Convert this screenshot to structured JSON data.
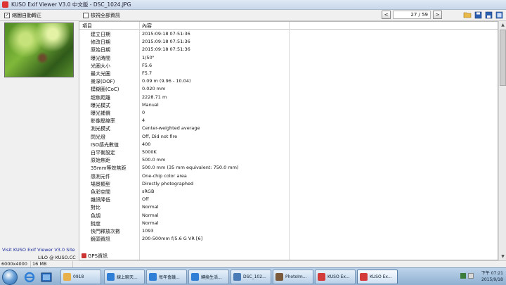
{
  "window": {
    "title": "KUSO Exif Viewer V3.0 中文版 - DSC_1024.JPG"
  },
  "toolbar": {
    "auto_rotate_label": "縮圖自動轉正",
    "auto_rotate_checked": true,
    "show_all_label": "檢視全部資訊",
    "show_all_checked": false,
    "prev_label": "<",
    "next_label": ">",
    "counter": "27 / 59"
  },
  "left": {
    "visit_text": "Visit KUSO Exif Viewer V3.0 Site",
    "credit_text": "LILO @ KUSO.CC"
  },
  "table": {
    "headers": [
      "項目",
      "內容"
    ],
    "rows": [
      {
        "key": "建立日期",
        "value": "2015:09:18 07:51:36"
      },
      {
        "key": "修改日期",
        "value": "2015:09:18 07:51:36"
      },
      {
        "key": "原始日期",
        "value": "2015:09:18 07:51:36"
      },
      {
        "key": "曝光時間",
        "value": "1/50\""
      },
      {
        "key": "光圈大小",
        "value": "F5.6"
      },
      {
        "key": "最大光圈",
        "value": "F5.7"
      },
      {
        "key": "景深(DOF)",
        "value": "0.09 m (9.96 - 10.04)"
      },
      {
        "key": "模糊圈(CoC)",
        "value": "0.020 mm"
      },
      {
        "key": "超焦距離",
        "value": "2228.71 m"
      },
      {
        "key": "曝光模式",
        "value": "Manual"
      },
      {
        "key": "曝光補償",
        "value": "0"
      },
      {
        "key": "影像壓縮率",
        "value": "4"
      },
      {
        "key": "測光模式",
        "value": "Center-weighted average"
      },
      {
        "key": "閃光燈",
        "value": "Off, Did not fire"
      },
      {
        "key": "ISO感光數值",
        "value": "400"
      },
      {
        "key": "白平衡設定",
        "value": "5000K"
      },
      {
        "key": "原始焦距",
        "value": "500.0 mm"
      },
      {
        "key": "35mm等效焦距",
        "value": "500.0 mm (35 mm equivalent: 750.0 mm)"
      },
      {
        "key": "感測元件",
        "value": "One-chip color area"
      },
      {
        "key": "場景類型",
        "value": "Directly photographed"
      },
      {
        "key": "色彩空間",
        "value": "sRGB"
      },
      {
        "key": "雜訊降低",
        "value": "Off"
      },
      {
        "key": "對比",
        "value": "Normal"
      },
      {
        "key": "色調",
        "value": "Normal"
      },
      {
        "key": "銳度",
        "value": "Normal"
      },
      {
        "key": "快門釋放次數",
        "value": "1093"
      },
      {
        "key": "鏡頭資訊",
        "value": "200-500mm f/5.6 G VR [6]"
      }
    ],
    "gps_label": "GPS資訊"
  },
  "status": {
    "dimensions": "6000x4000",
    "filesize": "16 MB"
  },
  "taskbar": {
    "items": [
      {
        "label": "0918",
        "icon": "folder-icon",
        "color": "#e8b04a"
      },
      {
        "label": "線上聊天...",
        "icon": "ie-icon",
        "color": "#2f7fd6"
      },
      {
        "label": "每年會議...",
        "icon": "ie-icon",
        "color": "#2f7fd6"
      },
      {
        "label": "轉換生活...",
        "icon": "ie-icon",
        "color": "#2f7fd6"
      },
      {
        "label": "DSC_102...",
        "icon": "image-icon",
        "color": "#4a7db8"
      },
      {
        "label": "PhotoIm...",
        "icon": "photo-app-icon",
        "color": "#7a5a3a"
      },
      {
        "label": "KUSO Ex...",
        "icon": "kuso-icon",
        "color": "#d33a3a"
      },
      {
        "label": "KUSO Ex...",
        "icon": "kuso-icon",
        "color": "#d33a3a"
      }
    ],
    "clock_time": "下午 07:21",
    "clock_date": "2015/9/18"
  }
}
